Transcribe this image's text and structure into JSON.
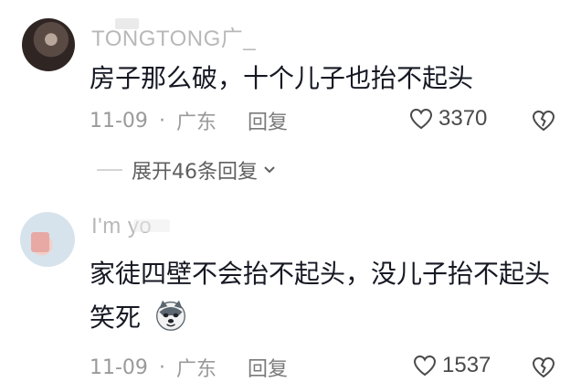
{
  "comments": [
    {
      "username": "TONGTONG广_",
      "text": "房子那么破，十个儿子也抬不起头",
      "date": "11-09",
      "location": "广东",
      "reply_label": "回复",
      "likes": "3370",
      "expand_label": "展开46条回复"
    },
    {
      "username": "I'm yo",
      "text": "家徒四壁不会抬不起头，没儿子抬不起头 笑死",
      "sticker_icon": "husky-dog-sticker",
      "date": "11-09",
      "location": "广东",
      "reply_label": "回复",
      "likes": "1537"
    }
  ],
  "icons": {
    "like": "heart-outline-icon",
    "dislike": "broken-heart-icon",
    "expand": "chevron-down-icon"
  },
  "colors": {
    "text": "#161823",
    "meta": "#9a9a9a",
    "username": "#b8b8b8"
  }
}
